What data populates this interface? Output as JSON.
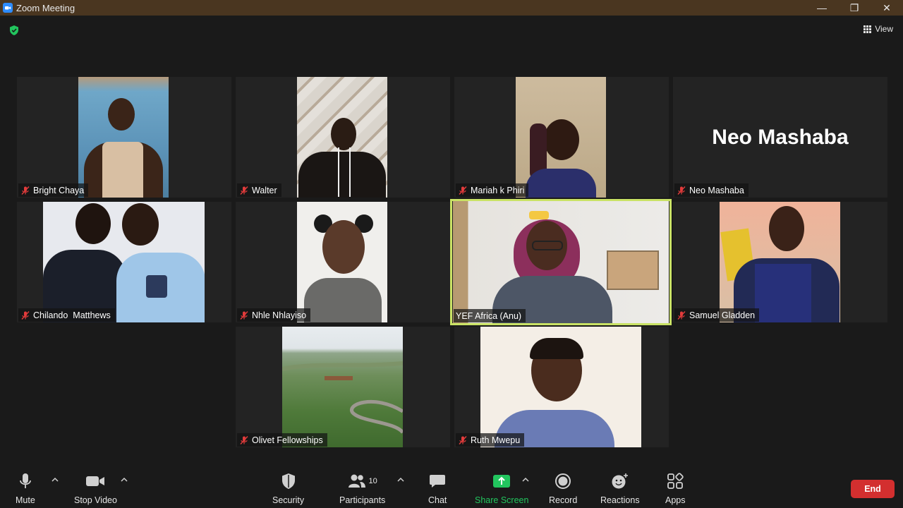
{
  "window": {
    "title": "Zoom Meeting",
    "controls": [
      "—",
      "❐",
      "✕"
    ]
  },
  "top_right": {
    "view_label": "View"
  },
  "participants": [
    {
      "name": "Bright Chaya",
      "muted": true,
      "video": true
    },
    {
      "name": "Walter",
      "muted": true,
      "video": true
    },
    {
      "name": "Mariah k Phiri",
      "muted": true,
      "video": true
    },
    {
      "name": "Neo Mashaba",
      "muted": true,
      "video": false,
      "display_name": "Neo Mashaba"
    },
    {
      "name": "Chilando  Matthews",
      "muted": true,
      "video": true
    },
    {
      "name": "Nhle Nhlayiso",
      "muted": true,
      "video": true
    },
    {
      "name": "YEF Africa (Anu)",
      "muted": false,
      "video": true,
      "active_speaker": true
    },
    {
      "name": "Samuel Gladden",
      "muted": true,
      "video": true
    },
    {
      "name": "Olivet Fellowships",
      "muted": true,
      "video": true
    },
    {
      "name": "Ruth Mwepu",
      "muted": true,
      "video": true
    }
  ],
  "toolbar": {
    "mute_label": "Mute",
    "stop_video_label": "Stop Video",
    "security_label": "Security",
    "participants_label": "Participants",
    "participants_count": "10",
    "chat_label": "Chat",
    "share_screen_label": "Share Screen",
    "record_label": "Record",
    "reactions_label": "Reactions",
    "apps_label": "Apps",
    "end_label": "End"
  },
  "colors": {
    "background": "#1a1a1a",
    "tile_background": "#232323",
    "titlebar": "#4a3620",
    "active_speaker_border": "#c9e265",
    "share_green": "#22c55e",
    "end_red": "#d32f2f",
    "muted_red": "#e23b3b"
  }
}
